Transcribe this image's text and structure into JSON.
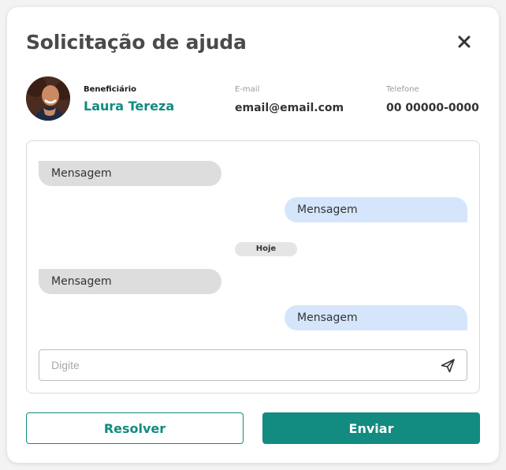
{
  "dialog": {
    "title": "Solicitação de ajuda",
    "close_icon": "close-icon"
  },
  "beneficiary": {
    "label": "Beneficiário",
    "name": "Laura Tereza"
  },
  "email": {
    "label": "E-mail",
    "value": "email@email.com"
  },
  "phone": {
    "label": "Telefone",
    "value": "00 00000-0000"
  },
  "chat": {
    "messages": [
      {
        "direction": "in",
        "text": "Mensagem"
      },
      {
        "direction": "out",
        "text": "Mensagem"
      },
      {
        "direction": "in",
        "text": "Mensagem"
      },
      {
        "direction": "out",
        "text": "Mensagem"
      }
    ],
    "day_separator": "Hoje",
    "input_placeholder": "Digite",
    "send_icon": "send-icon"
  },
  "actions": {
    "resolve_label": "Resolver",
    "send_label": "Enviar"
  },
  "colors": {
    "accent": "#128b80",
    "incoming_bubble": "#dddddd",
    "outgoing_bubble": "#d5e6fc"
  }
}
